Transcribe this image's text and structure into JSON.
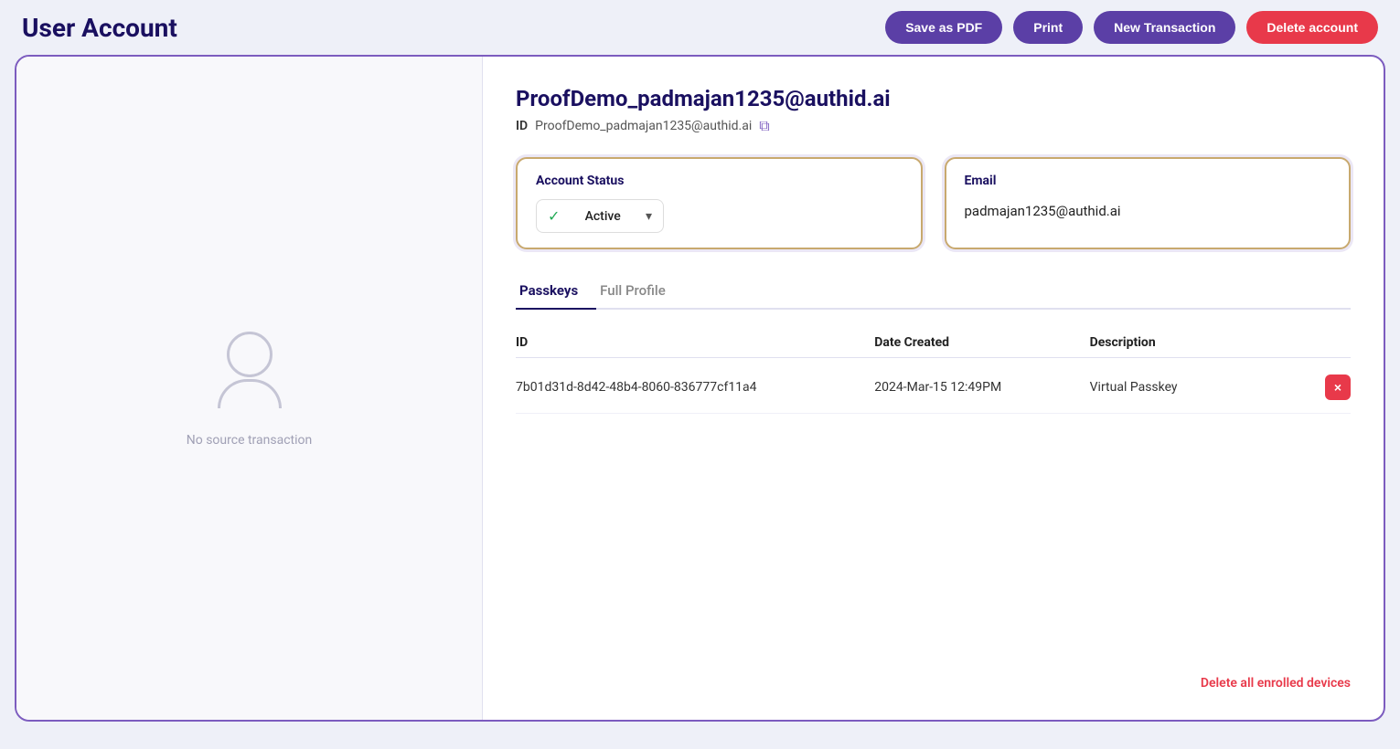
{
  "header": {
    "title": "User Account",
    "actions": {
      "save_as_pdf": "Save as PDF",
      "print": "Print",
      "new_transaction": "New Transaction",
      "delete_account": "Delete account"
    }
  },
  "user": {
    "email": "ProofDemo_padmajan1235@authid.ai",
    "id_label": "ID",
    "id_value": "ProofDemo_padmajan1235@authid.ai",
    "no_source": "No source transaction"
  },
  "account_status_card": {
    "title": "Account Status",
    "status_label": "Active"
  },
  "email_card": {
    "title": "Email",
    "email_value": "padmajan1235@authid.ai"
  },
  "tabs": [
    {
      "label": "Passkeys",
      "active": true
    },
    {
      "label": "Full Profile",
      "active": false
    }
  ],
  "table": {
    "columns": {
      "id": "ID",
      "date_created": "Date Created",
      "description": "Description"
    },
    "rows": [
      {
        "id": "7b01d31d-8d42-48b4-8060-836777cf11a4",
        "date_created": "2024-Mar-15 12:49PM",
        "description": "Virtual Passkey"
      }
    ]
  },
  "footer": {
    "delete_all_label": "Delete all enrolled devices"
  },
  "icons": {
    "copy": "⧉",
    "chevron_down": "▾",
    "check_circle": "✓",
    "close": "×"
  }
}
